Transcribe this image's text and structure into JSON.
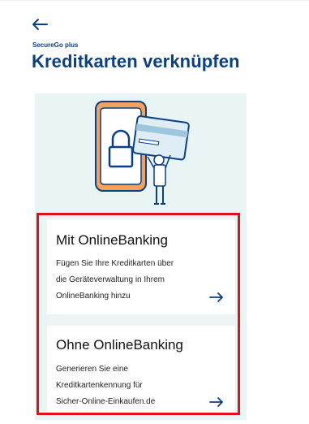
{
  "header": {
    "overline": "SecureGo plus",
    "title": "Kreditkarten verknüpfen"
  },
  "options": [
    {
      "title": "Mit OnlineBanking",
      "lines": [
        "Fügen Sie Ihre Kreditkarten über",
        "die Geräteverwaltung in Ihrem",
        "OnlineBanking hinzu"
      ]
    },
    {
      "title": "Ohne OnlineBanking",
      "lines": [
        "Generieren Sie eine",
        "Kreditkartenkennung für",
        "Sicher-Online-Einkaufen.de"
      ]
    }
  ],
  "icons": {
    "back": "arrow-left-icon",
    "option_arrow": "arrow-right-icon"
  },
  "colors": {
    "brand_blue": "#0a3f86",
    "panel_bg": "#e9f4f5",
    "highlight_red": "#e0111b",
    "accent_orange": "#f3a35c"
  }
}
